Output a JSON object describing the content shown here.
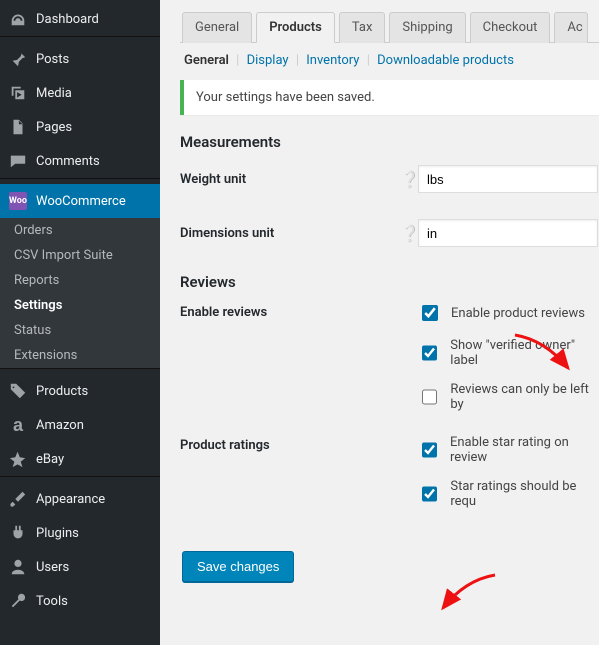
{
  "sidebar": {
    "top": [
      {
        "label": "Dashboard",
        "icon": "dashboard"
      },
      {
        "label": "Posts",
        "icon": "pin"
      },
      {
        "label": "Media",
        "icon": "media"
      },
      {
        "label": "Pages",
        "icon": "pages"
      },
      {
        "label": "Comments",
        "icon": "comment"
      }
    ],
    "woocommerce_label": "WooCommerce",
    "woo_sub": [
      {
        "label": "Orders",
        "current": false
      },
      {
        "label": "CSV Import Suite",
        "current": false
      },
      {
        "label": "Reports",
        "current": false
      },
      {
        "label": "Settings",
        "current": true
      },
      {
        "label": "Status",
        "current": false
      },
      {
        "label": "Extensions",
        "current": false
      }
    ],
    "bottom": [
      {
        "label": "Products",
        "icon": "products"
      },
      {
        "label": "Amazon",
        "icon": "amazon"
      },
      {
        "label": "eBay",
        "icon": "ebay"
      },
      {
        "label": "Appearance",
        "icon": "brush"
      },
      {
        "label": "Plugins",
        "icon": "plug"
      },
      {
        "label": "Users",
        "icon": "users"
      },
      {
        "label": "Tools",
        "icon": "wrench"
      }
    ]
  },
  "tabs": [
    "General",
    "Products",
    "Tax",
    "Shipping",
    "Checkout",
    "Accounts"
  ],
  "active_tab_index": 1,
  "subtabs": [
    "General",
    "Display",
    "Inventory",
    "Downloadable products"
  ],
  "active_subtab_index": 0,
  "notice_text": "Your settings have been saved.",
  "measurements": {
    "heading": "Measurements",
    "weight_label": "Weight unit",
    "weight_value": "lbs",
    "dimensions_label": "Dimensions unit",
    "dimensions_value": "in"
  },
  "reviews": {
    "heading": "Reviews",
    "enable_label": "Enable reviews",
    "ratings_label": "Product ratings",
    "options": {
      "enable_reviews": {
        "text": "Enable product reviews",
        "checked": true
      },
      "verified_owner": {
        "text": "Show \"verified owner\" label",
        "checked": true
      },
      "only_verified": {
        "text": "Reviews can only be left by",
        "checked": false
      },
      "star_rating": {
        "text": "Enable star rating on review",
        "checked": true
      },
      "star_required": {
        "text": "Star ratings should be requ",
        "checked": true
      }
    }
  },
  "save_button_label": "Save changes"
}
